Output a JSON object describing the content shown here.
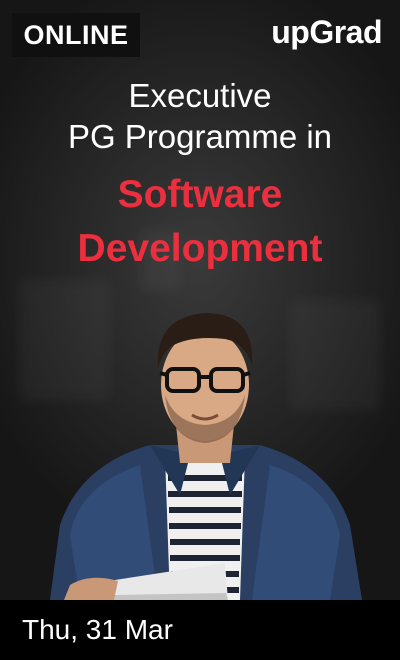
{
  "badge": {
    "label": "ONLINE"
  },
  "brand": {
    "logo_text": "upGrad"
  },
  "heading": {
    "line1": "Executive",
    "line2": "PG Programme in"
  },
  "subject": {
    "line1": "Software",
    "line2": "Development"
  },
  "event": {
    "date": "Thu, 31 Mar"
  },
  "colors": {
    "accent_red": "#ec2f3e",
    "text_white": "#ffffff",
    "date_bar_bg": "#000000",
    "badge_bg": "#101010"
  }
}
